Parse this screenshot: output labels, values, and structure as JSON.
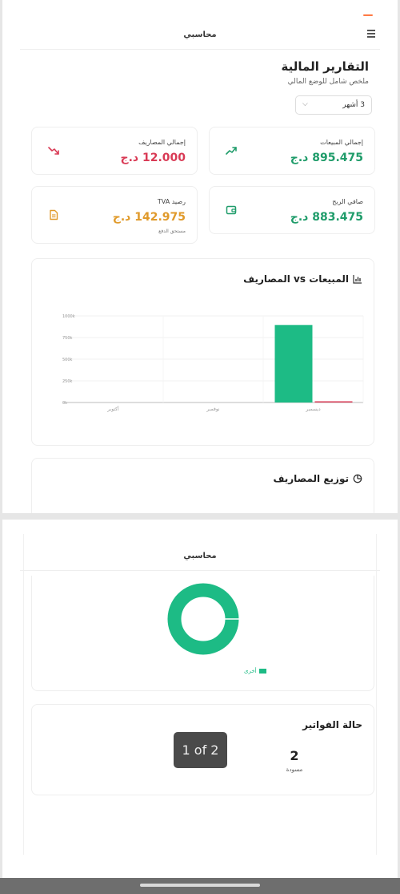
{
  "app": {
    "title": "محاسبي"
  },
  "report": {
    "title": "التقارير المالية",
    "subtitle": "ملخص شامل للوضع المالي",
    "period": "3 أشهر"
  },
  "stats": {
    "sales": {
      "label": "إجمالي المبيعات",
      "value": "895.475 د.ج",
      "icon": "trending-up-icon"
    },
    "expenses": {
      "label": "إجمالي المصاريف",
      "value": "12.000 د.ج",
      "icon": "trending-down-icon"
    },
    "profit": {
      "label": "صافي الربح",
      "value": "883.475 د.ج",
      "icon": "wallet-icon"
    },
    "tva": {
      "label": "رصيد TVA",
      "value": "142.975 د.ج",
      "sub": "مستحق الدفع",
      "icon": "document-icon"
    }
  },
  "sales_chart": {
    "title": "المبيعات vs المصاريف",
    "icon": "bar-chart-icon"
  },
  "expense_distribution": {
    "title": "توزيع المصاريف",
    "icon": "pie-chart-icon",
    "legend": [
      "أخرى"
    ]
  },
  "invoice_status": {
    "title": "حالة الفواتير",
    "draft_count": "2",
    "draft_label": "مسودة"
  },
  "pager": {
    "label": "1 of 2"
  },
  "colors": {
    "green": "#1f9c6a",
    "chart_green": "#1dbb85",
    "red": "#d93a55",
    "orange": "#e09a2b",
    "accent": "#ff7a45"
  },
  "chart_data": [
    {
      "type": "bar",
      "categories": [
        "أكتوبر",
        "نوفمبر",
        "ديسمبر"
      ],
      "series": [
        {
          "values": [
            0,
            0,
            895475
          ],
          "color": "#1dbb85"
        },
        {
          "values": [
            0,
            0,
            12000
          ],
          "color": "#d93a55"
        }
      ],
      "yticks": [
        "0k",
        "250k",
        "500k",
        "750k",
        "1000k"
      ],
      "ylim": [
        0,
        1000000
      ],
      "grid": true
    },
    {
      "type": "pie",
      "categories": [
        "أخرى"
      ],
      "values": [
        12000
      ],
      "colors": [
        "#1dbb85"
      ]
    }
  ]
}
